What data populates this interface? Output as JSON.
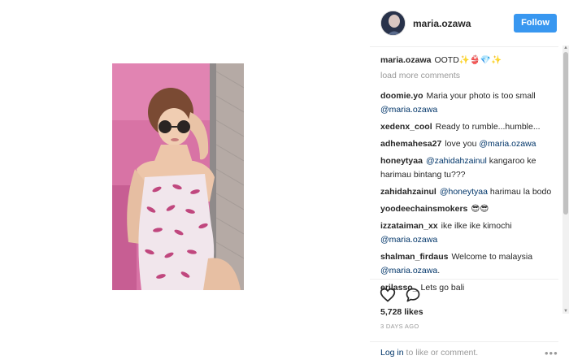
{
  "post": {
    "username": "maria.ozawa",
    "follow_label": "Follow",
    "caption": "OOTD✨👙💎✨",
    "load_more": "load more comments",
    "likes": "5,728 likes",
    "timestamp": "3 DAYS AGO"
  },
  "comments": [
    {
      "user": "doomie.yo",
      "text": "Maria your photo is too small ",
      "mention": "@maria.ozawa",
      "after": ""
    },
    {
      "user": "xedenx_cool",
      "text": "Ready to rumble...humble...",
      "mention": "",
      "after": ""
    },
    {
      "user": "adhemahesa27",
      "text": "love you ",
      "mention": "@maria.ozawa",
      "after": ""
    },
    {
      "user": "honeytyaa",
      "text": "",
      "mention": "@zahidahzainul",
      "after": " kangaroo ke harimau bintang tu???"
    },
    {
      "user": "zahidahzainul",
      "text": "",
      "mention": "@honeytyaa",
      "after": " harimau la bodo"
    },
    {
      "user": "yoodeechainsmokers",
      "text": "😎😎",
      "mention": "",
      "after": ""
    },
    {
      "user": "izzataiman_xx",
      "text": "ike ilke ike kimochi ",
      "mention": "@maria.ozawa",
      "after": ""
    },
    {
      "user": "shalman_firdaus",
      "text": "Welcome to malaysia ",
      "mention": "@maria.ozawa",
      "after": "."
    },
    {
      "user": "erilasso_",
      "text": "Lets go bali",
      "mention": "",
      "after": ""
    }
  ],
  "footer": {
    "login_link": "Log in",
    "login_rest": " to like or comment.",
    "more": "•••"
  },
  "icons": {
    "like": "heart-icon",
    "comment": "comment-icon",
    "more": "more-options-icon"
  },
  "colors": {
    "follow_button": "#3897f0",
    "mention": "#003569",
    "muted": "#999999",
    "lounger_pink": "#d66fa0"
  }
}
